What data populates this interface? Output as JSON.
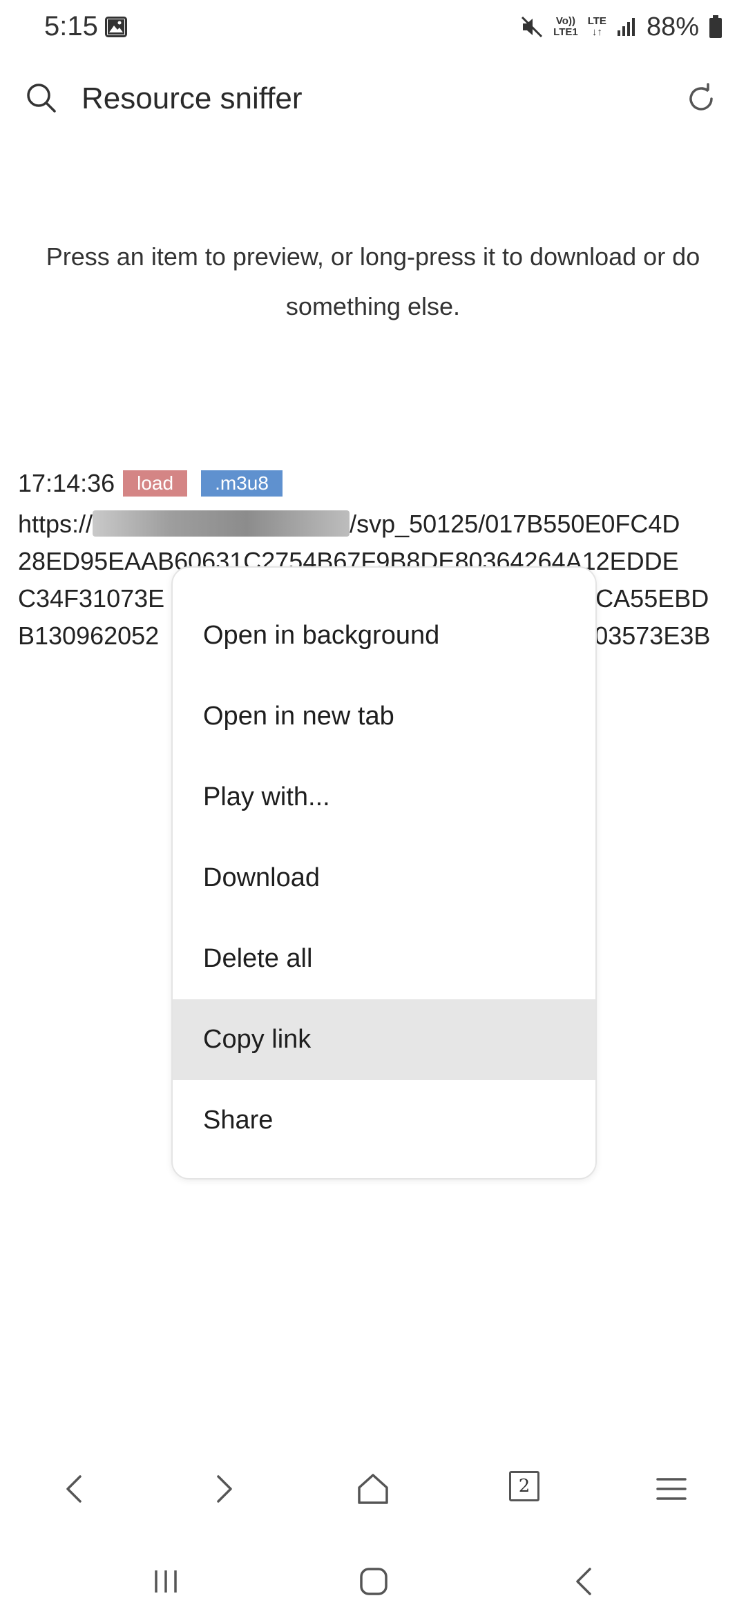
{
  "status_bar": {
    "time": "5:15",
    "battery": "88%",
    "network_top": "Vo))",
    "network_bottom": "LTE1",
    "network_type": "LTE",
    "icons": [
      "image-icon",
      "mute-icon",
      "signal-icon",
      "battery-icon"
    ]
  },
  "app_bar": {
    "title": "Resource sniffer",
    "icons": [
      "search-icon",
      "refresh-icon"
    ]
  },
  "hint": "Press an item to preview, or long-press it to download or do something else.",
  "resource": {
    "time": "17:14:36",
    "badge_load": "load",
    "badge_type": ".m3u8",
    "url_prefix": "https://",
    "url_line1_suffix": "/svp_50125/017B550E0FC4D",
    "url_line2": "28ED95EAAB60631C2754B67F9B8DE80364264A12EDDE",
    "url_line3_start": "C34F31073E",
    "url_line3_end": "BCA55EBD",
    "url_line4_start": "B130962052",
    "url_line4_end": "03573E3B"
  },
  "context_menu": {
    "items": [
      {
        "label": "Open in background"
      },
      {
        "label": "Open in new tab"
      },
      {
        "label": "Play with..."
      },
      {
        "label": "Download"
      },
      {
        "label": "Delete all"
      },
      {
        "label": "Copy link",
        "highlighted": true
      },
      {
        "label": "Share"
      }
    ]
  },
  "browser_toolbar": {
    "tab_count": "2",
    "icons": [
      "back-icon",
      "forward-icon",
      "home-icon",
      "tabs-icon",
      "menu-icon"
    ]
  },
  "system_nav": {
    "icons": [
      "recents-icon",
      "home-icon",
      "back-icon"
    ]
  },
  "colors": {
    "badge_load": "#d48585",
    "badge_type": "#5f91cf",
    "menu_highlight": "#e6e6e6"
  }
}
